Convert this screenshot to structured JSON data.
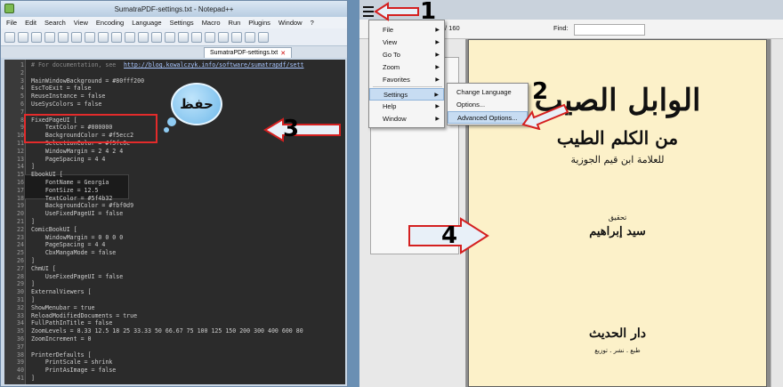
{
  "notepad": {
    "title": "SumatraPDF-settings.txt - Notepad++",
    "menu": [
      "File",
      "Edit",
      "Search",
      "View",
      "Encoding",
      "Language",
      "Settings",
      "Macro",
      "Run",
      "Plugins",
      "Window",
      "?"
    ],
    "tab": "SumatraPDF-settings.txt",
    "lines": [
      {
        "n": "1",
        "t": "# For documentation, see ",
        "url": "http://blog.kowalczyk.info/software/sumatrapdf/sett"
      },
      {
        "n": "2",
        "t": ""
      },
      {
        "n": "3",
        "t": "MainWindowBackground = #80fff200"
      },
      {
        "n": "4",
        "t": "EscToExit = false"
      },
      {
        "n": "5",
        "t": "ReuseInstance = false"
      },
      {
        "n": "6",
        "t": "UseSysColors = false"
      },
      {
        "n": "7",
        "t": ""
      },
      {
        "n": "8",
        "t": "FixedPageUI ["
      },
      {
        "n": "9",
        "t": "    TextColor = #000000"
      },
      {
        "n": "10",
        "t": "    BackgroundColor = #f5ecc2"
      },
      {
        "n": "11",
        "t": "    SelectionColor = #f5fc0c"
      },
      {
        "n": "12",
        "t": "    WindowMargin = 2 4 2 4"
      },
      {
        "n": "13",
        "t": "    PageSpacing = 4 4"
      },
      {
        "n": "14",
        "t": "]"
      },
      {
        "n": "15",
        "t": "EbookUI ["
      },
      {
        "n": "16",
        "t": "    FontName = Georgia"
      },
      {
        "n": "17",
        "t": "    FontSize = 12.5"
      },
      {
        "n": "18",
        "t": "    TextColor = #5f4b32"
      },
      {
        "n": "19",
        "t": "    BackgroundColor = #fbf0d9"
      },
      {
        "n": "20",
        "t": "    UseFixedPageUI = false"
      },
      {
        "n": "21",
        "t": "]"
      },
      {
        "n": "22",
        "t": "ComicBookUI ["
      },
      {
        "n": "23",
        "t": "    WindowMargin = 0 0 0 0"
      },
      {
        "n": "24",
        "t": "    PageSpacing = 4 4"
      },
      {
        "n": "25",
        "t": "    CbxMangaMode = false"
      },
      {
        "n": "26",
        "t": "]"
      },
      {
        "n": "27",
        "t": "ChmUI ["
      },
      {
        "n": "28",
        "t": "    UseFixedPageUI = false"
      },
      {
        "n": "29",
        "t": "]"
      },
      {
        "n": "30",
        "t": "ExternalViewers ["
      },
      {
        "n": "31",
        "t": "]"
      },
      {
        "n": "32",
        "t": "ShowMenubar = true"
      },
      {
        "n": "33",
        "t": "ReloadModifiedDocuments = true"
      },
      {
        "n": "34",
        "t": "FullPathInTitle = false"
      },
      {
        "n": "35",
        "t": "ZoomLevels = 8.33 12.5 18 25 33.33 50 66.67 75 100 125 150 200 300 400 600 80"
      },
      {
        "n": "36",
        "t": "ZoomIncrement = 0"
      },
      {
        "n": "37",
        "t": ""
      },
      {
        "n": "38",
        "t": "PrinterDefaults ["
      },
      {
        "n": "39",
        "t": "    PrintScale = shrink"
      },
      {
        "n": "40",
        "t": "    PrintAsImage = false"
      },
      {
        "n": "41",
        "t": "]"
      }
    ]
  },
  "bubble_text": "حفظ",
  "sumatra": {
    "page_field": "/ 160",
    "find_label": "Find:",
    "main_menu": [
      {
        "label": "File",
        "sub": true
      },
      {
        "label": "View",
        "sub": true
      },
      {
        "label": "Go To",
        "sub": true
      },
      {
        "label": "Zoom",
        "sub": true
      },
      {
        "label": "Favorites",
        "sub": true
      },
      {
        "label": "Settings",
        "sub": true
      },
      {
        "label": "Help",
        "sub": true
      },
      {
        "label": "Window",
        "sub": true
      }
    ],
    "settings_submenu": [
      "Change Language",
      "Options...",
      "Advanced Options..."
    ],
    "book": {
      "title": "الوابل الصيب",
      "subtitle": "من الكلم الطيب",
      "author": "للعلامة ابن قيم الجوزية",
      "editor_label": "تحقيق",
      "editor": "سيد إبراهيم",
      "publisher": "دار الحديث",
      "publisher_sub": "طبع . نشر . توزيع"
    }
  },
  "annotations": {
    "n1": "1",
    "n2": "2",
    "n3": "3",
    "n4": "4",
    "arrow_color": "#e8f0f8",
    "arrow_outline": "#d42020"
  },
  "colors": {
    "editor_bg": "#2b2b2b",
    "page_bg": "#fcf1c9",
    "highlight_border": "#e32b2b"
  }
}
